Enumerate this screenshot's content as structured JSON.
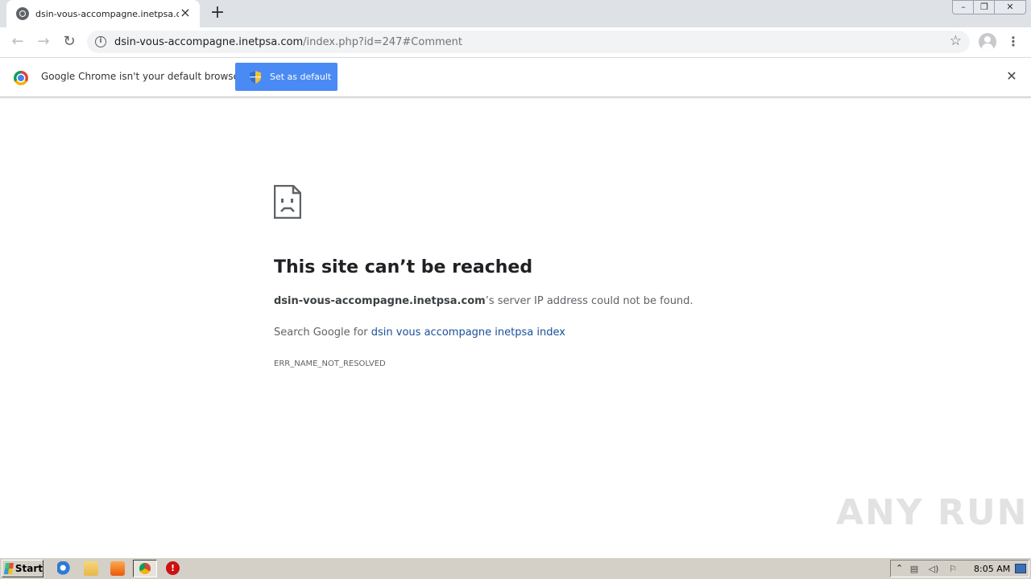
{
  "browser": {
    "tab": {
      "title": "dsin-vous-accompagne.inetpsa.com"
    },
    "url": {
      "host": "dsin-vous-accompagne.inetpsa.com",
      "path": "/index.php?id=247#Comment"
    }
  },
  "infobar": {
    "message": "Google Chrome isn't your default browser",
    "button_label": "Set as default"
  },
  "error": {
    "title": "This site can’t be reached",
    "host_bold": "dsin-vous-accompagne.inetpsa.com",
    "message_suffix": "’s server IP address could not be found.",
    "search_prefix": "Search Google for ",
    "search_link": "dsin vous accompagne inetpsa index",
    "code": "ERR_NAME_NOT_RESOLVED"
  },
  "watermark": {
    "text": "ANY RUN"
  },
  "taskbar": {
    "start_label": "Start",
    "clock": "8:05 AM"
  },
  "colors": {
    "accent_button": "#4a8af4",
    "link": "#1a4f99",
    "tabstrip": "#dee1e6"
  }
}
